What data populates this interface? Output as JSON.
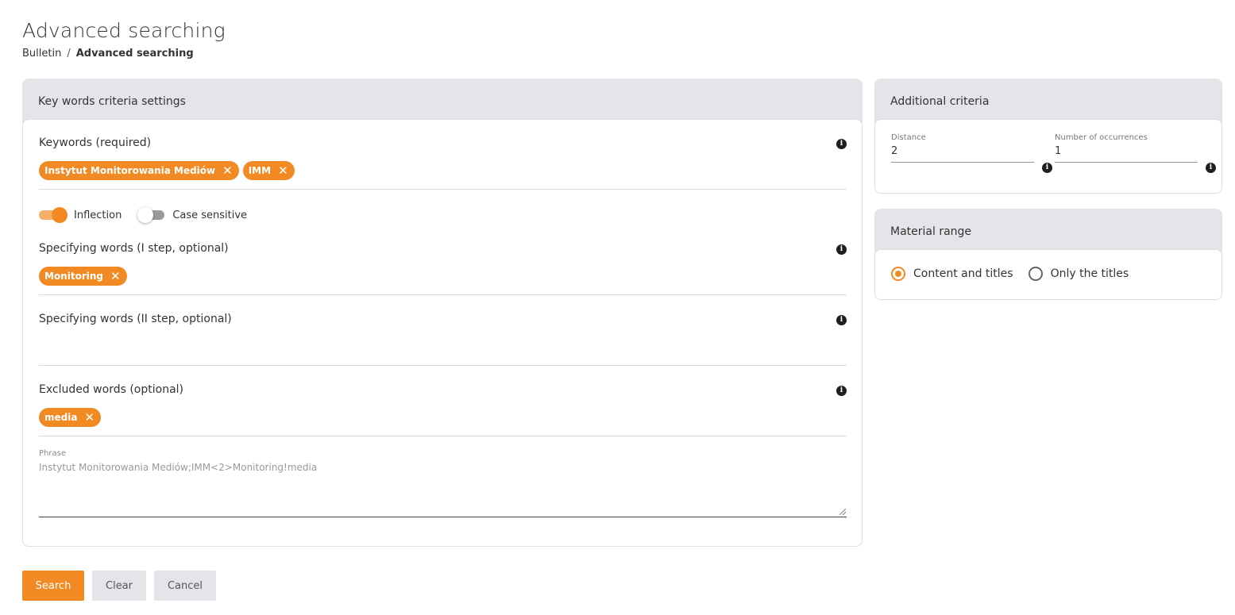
{
  "page": {
    "title": "Advanced searching",
    "breadcrumb": {
      "root": "Bulletin",
      "separator": "/",
      "current": "Advanced searching"
    }
  },
  "main_card": {
    "header": "Key words criteria settings",
    "keywords": {
      "label": "Keywords (required)",
      "chips": [
        "Instytut Monitorowania Mediów",
        "IMM"
      ]
    },
    "toggles": {
      "inflection": {
        "label": "Inflection",
        "on": true
      },
      "case_sensitive": {
        "label": "Case sensitive",
        "on": false
      }
    },
    "specifying_1": {
      "label": "Specifying words (I step, optional)",
      "chips": [
        "Monitoring"
      ]
    },
    "specifying_2": {
      "label": "Specifying words (II step, optional)",
      "chips": []
    },
    "excluded": {
      "label": "Excluded words (optional)",
      "chips": [
        "media"
      ]
    },
    "phrase": {
      "label": "Phrase",
      "value": "Instytut Monitorowania Mediów;IMM<2>Monitoring!media"
    }
  },
  "additional_card": {
    "header": "Additional criteria",
    "distance": {
      "label": "Distance",
      "value": "2"
    },
    "occurrences": {
      "label": "Number of occurrences",
      "value": "1"
    }
  },
  "range_card": {
    "header": "Material range",
    "options": [
      {
        "label": "Content and titles",
        "checked": true
      },
      {
        "label": "Only the titles",
        "checked": false
      }
    ]
  },
  "buttons": {
    "search": "Search",
    "clear": "Clear",
    "cancel": "Cancel"
  },
  "icons": {
    "info": "info-icon",
    "remove": "close-icon"
  },
  "colors": {
    "accent": "#f28a24",
    "card_header_bg": "#e3e5e8"
  },
  "chip_remove_glyph": "✕",
  "info_glyph": "i"
}
